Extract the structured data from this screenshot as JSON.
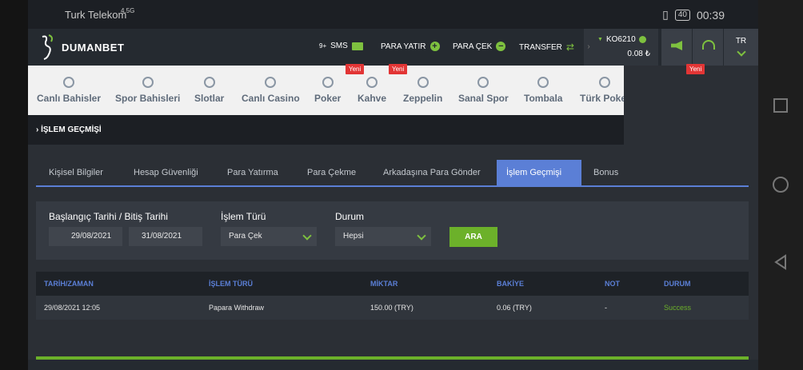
{
  "statusbar": {
    "carrier": "Turk Telekom",
    "network": "4.5G",
    "battery": "40",
    "time": "00:39"
  },
  "brand": {
    "name": "DUMANBET"
  },
  "header": {
    "sms_count": "9+",
    "sms": "SMS",
    "deposit": "PARA YATIR",
    "withdraw": "PARA ÇEK",
    "transfer": "TRANSFER",
    "username": "KO6210",
    "balance": "0.08 ₺",
    "lang": "TR"
  },
  "badges": {
    "new": "Yeni"
  },
  "categories": [
    {
      "label": "Canlı Bahisler",
      "icon": "live-signal-icon"
    },
    {
      "label": "Spor Bahisleri",
      "icon": "football-icon"
    },
    {
      "label": "Slotlar",
      "icon": "slot-icon"
    },
    {
      "label": "Canlı Casino",
      "icon": "casino-icon"
    },
    {
      "label": "Poker",
      "icon": "poker-chip-icon"
    },
    {
      "label": "Kahve",
      "icon": "dice-icon"
    },
    {
      "label": "Zeppelin",
      "icon": "zeppelin-icon"
    },
    {
      "label": "Sanal Spor",
      "icon": "tv-icon"
    },
    {
      "label": "Tombala",
      "icon": "bingo-ball-icon"
    },
    {
      "label": "Türk Poker",
      "icon": "poker-chip-icon"
    }
  ],
  "breadcrumb": {
    "label": "İŞLEM GEÇMİŞİ"
  },
  "tabs": [
    {
      "label": "Kişisel Bilgiler"
    },
    {
      "label": "Hesap Güvenliği"
    },
    {
      "label": "Para Yatırma"
    },
    {
      "label": "Para Çekme"
    },
    {
      "label": "Arkadaşına Para Gönder"
    },
    {
      "label": "İşlem Geçmişi",
      "active": true
    },
    {
      "label": "Bonus"
    }
  ],
  "filter": {
    "date_label": "Başlangıç Tarihi / Bitiş Tarihi",
    "start_date": "29/08/2021",
    "end_date": "31/08/2021",
    "type_label": "İşlem Türü",
    "type_value": "Para Çek",
    "status_label": "Durum",
    "status_value": "Hepsi",
    "search_button": "ARA"
  },
  "table": {
    "headers": [
      "TARİH/ZAMAN",
      "İŞLEM TÜRÜ",
      "MİKTAR",
      "BAKİYE",
      "NOT",
      "DURUM"
    ],
    "rows": [
      {
        "date": "29/08/2021 12:05",
        "type": "Papara Withdraw",
        "amount": "150.00 (TRY)",
        "balance": "0.06 (TRY)",
        "note": "-",
        "status": "Success"
      }
    ]
  },
  "colors": {
    "accent": "#6cb12a",
    "tab_active": "#5b7fd6",
    "badge": "#e23535"
  }
}
